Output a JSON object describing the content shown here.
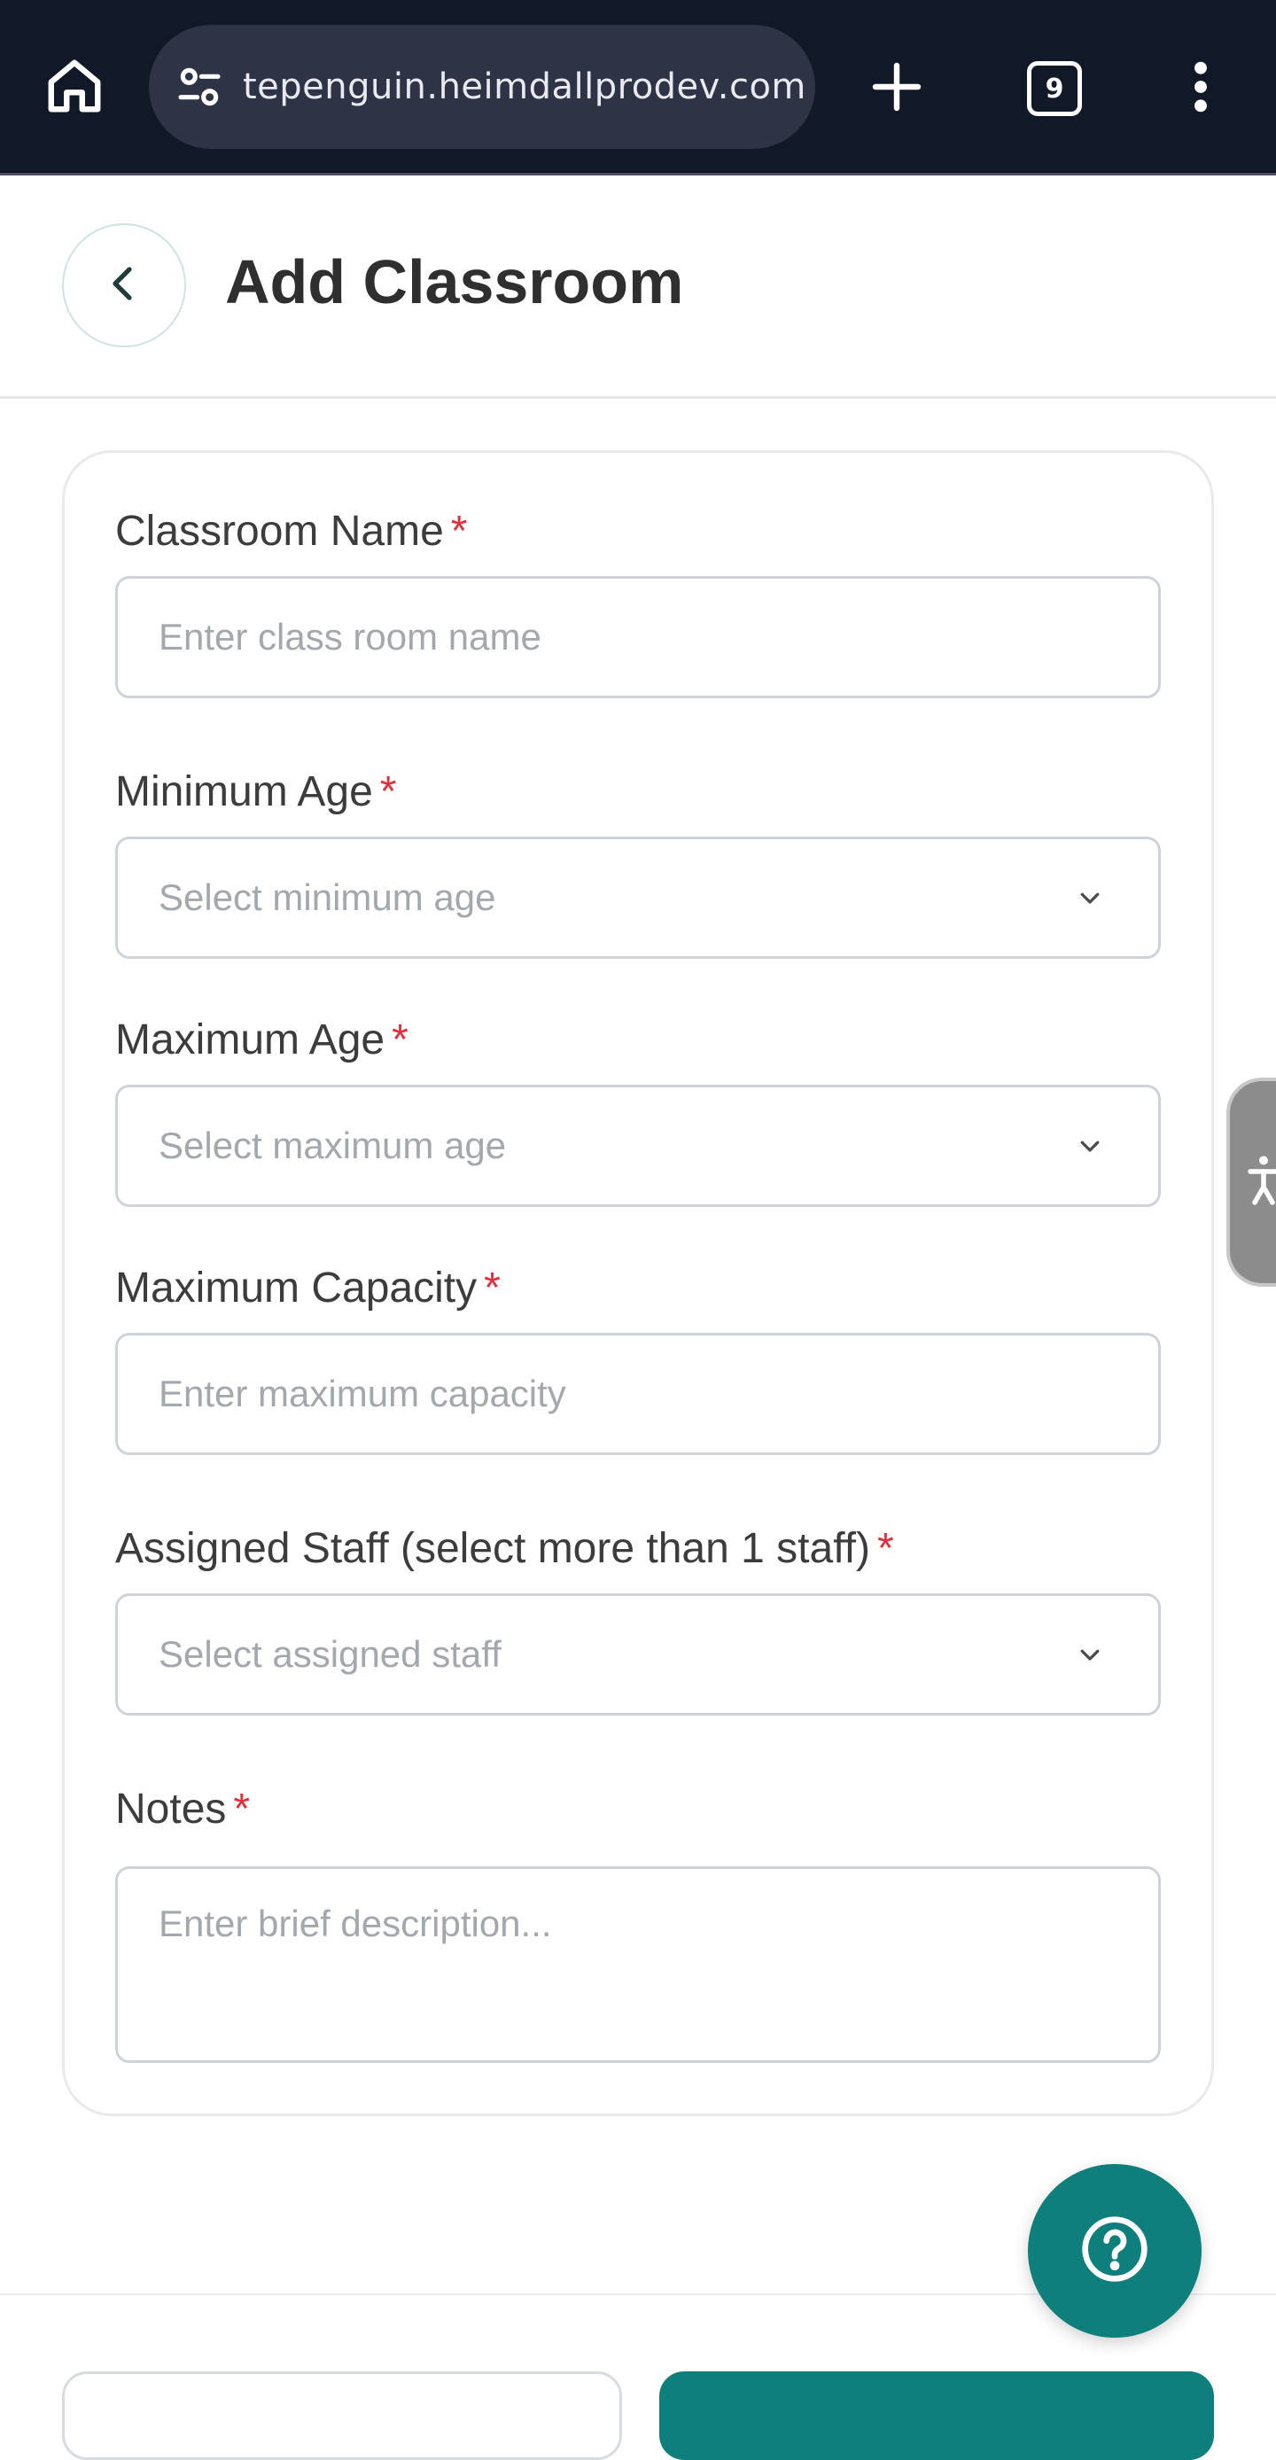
{
  "browser": {
    "url": "tepenguin.heimdallprodev.com",
    "tab_count": "9"
  },
  "header": {
    "title": "Add Classroom"
  },
  "form": {
    "classroom_name": {
      "label": "Classroom Name",
      "required": "*",
      "placeholder": "Enter class room name"
    },
    "minimum_age": {
      "label": "Minimum Age",
      "required": "*",
      "placeholder": "Select minimum age"
    },
    "maximum_age": {
      "label": "Maximum Age",
      "required": "*",
      "placeholder": "Select maximum age"
    },
    "maximum_capacity": {
      "label": "Maximum Capacity",
      "required": "*",
      "placeholder": "Enter maximum capacity"
    },
    "assigned_staff": {
      "label": "Assigned Staff (select more than 1 staff)",
      "required": "*",
      "placeholder": "Select assigned staff"
    },
    "notes": {
      "label": "Notes",
      "required": "*",
      "placeholder": "Enter brief description..."
    }
  },
  "colors": {
    "brand_teal": "#0f7f7c",
    "required_red": "#e0303d",
    "chrome_bg": "#111827"
  },
  "icons": [
    "home-icon",
    "site-settings-icon",
    "plus-icon",
    "tabs-icon",
    "more-vert-icon",
    "chevron-left-icon",
    "chevron-down-icon",
    "accessibility-icon",
    "help-icon"
  ]
}
